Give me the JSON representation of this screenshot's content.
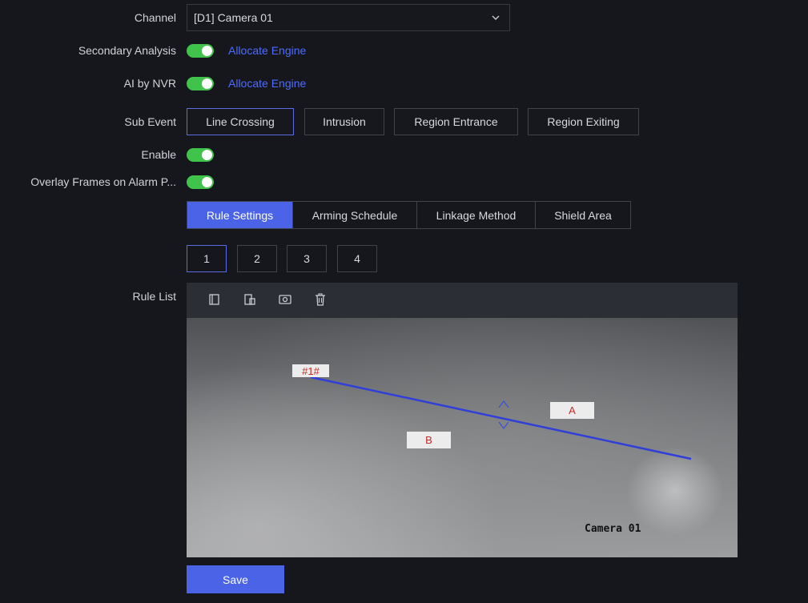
{
  "form": {
    "channel_label": "Channel",
    "channel_value": "[D1] Camera 01",
    "secondary_analysis_label": "Secondary Analysis",
    "secondary_analysis_on": true,
    "secondary_allocate_link": "Allocate Engine",
    "ai_by_nvr_label": "AI by NVR",
    "ai_by_nvr_on": true,
    "ai_allocate_link": "Allocate Engine",
    "sub_event_label": "Sub Event",
    "sub_events": [
      "Line Crossing",
      "Intrusion",
      "Region Entrance",
      "Region Exiting"
    ],
    "sub_event_selected": "Line Crossing",
    "enable_label": "Enable",
    "enable_on": true,
    "overlay_label": "Overlay Frames on Alarm P...",
    "overlay_on": true
  },
  "tabs": [
    "Rule Settings",
    "Arming Schedule",
    "Linkage Method",
    "Shield Area"
  ],
  "active_tab": "Rule Settings",
  "rule_numbers": [
    "1",
    "2",
    "3",
    "4"
  ],
  "active_rule": "1",
  "rule_list": {
    "label": "Rule List",
    "tool_icons": [
      "draw-rule-icon",
      "draw-area-icon",
      "clear-icon",
      "delete-icon"
    ]
  },
  "video": {
    "rule_tag": "#1#",
    "side_a": "A",
    "side_b": "B",
    "osd_camera": "Camera 01",
    "line_color": "#2f3fd8"
  },
  "save_label": "Save",
  "colors": {
    "accent": "#4b63e6",
    "toggle_on": "#3fc34a",
    "link": "#4f6bff"
  }
}
